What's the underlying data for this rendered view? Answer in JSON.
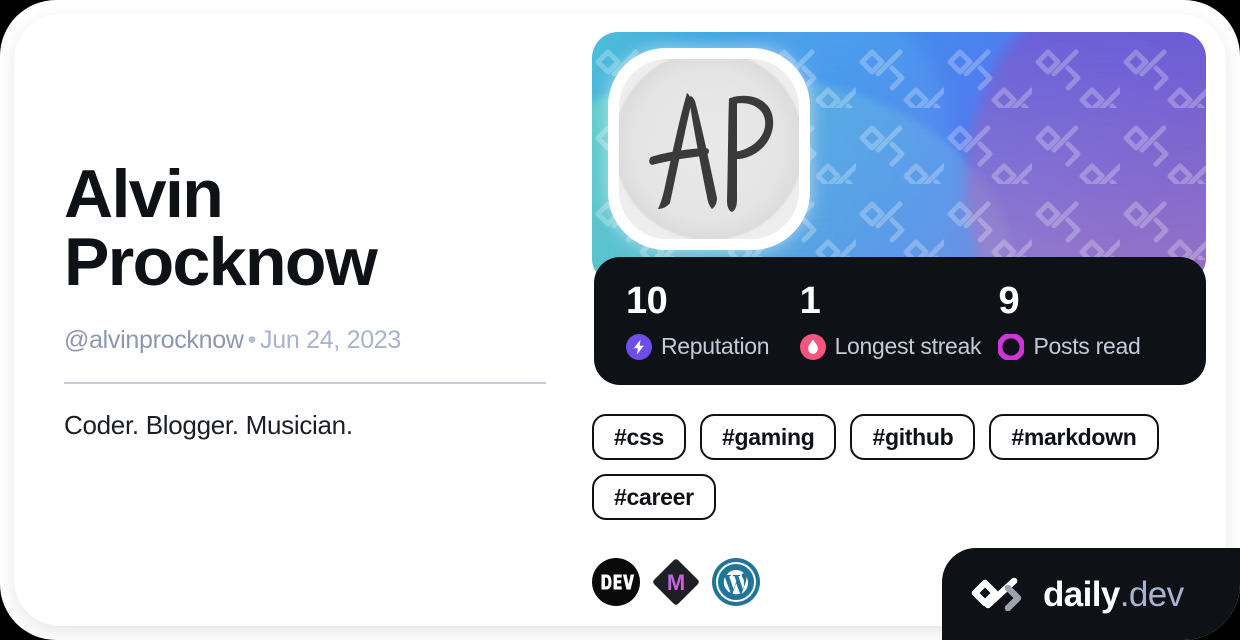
{
  "card": {
    "background_color": "#ffffff",
    "page_background": "#000000"
  },
  "profile": {
    "name": "Alvin Procknow",
    "handle": "@alvinprocknow",
    "separator": "•",
    "joined_date": "Jun 24, 2023",
    "bio": "Coder. Blogger. Musician.",
    "avatar_monogram": "AP",
    "avatar_alt": "AP monogram avatar"
  },
  "cover": {
    "gradient_from": "#4fc0d8",
    "gradient_mid": "#4f7ef0",
    "gradient_to": "#6257d4",
    "watermark": "daily-dev-logo-pattern"
  },
  "stats": [
    {
      "value": "10",
      "label": "Reputation",
      "icon": "reputation-bolt-icon",
      "color": "#6e4dea"
    },
    {
      "value": "1",
      "label": "Longest streak",
      "icon": "streak-flame-icon",
      "color": "#f6557d"
    },
    {
      "value": "9",
      "label": "Posts read",
      "icon": "posts-read-ring-icon",
      "color": "#cf35d9"
    }
  ],
  "stats_bar": {
    "background_color": "#0e1217"
  },
  "tags": [
    {
      "label": "#css"
    },
    {
      "label": "#gaming"
    },
    {
      "label": "#github"
    },
    {
      "label": "#markdown"
    },
    {
      "label": "#career"
    }
  ],
  "socials": [
    {
      "name": "dev-to-icon",
      "label": "DEV",
      "color": "#0a0a0a"
    },
    {
      "name": "medium-m-icon",
      "label": "M",
      "color": "#1d1f24"
    },
    {
      "name": "wordpress-icon",
      "label": "WordPress",
      "color": "#21759b"
    }
  ],
  "branding": {
    "logo": "daily-dev-logo",
    "name_bold": "daily",
    "name_light": ".dev",
    "background_color": "#0e1217"
  }
}
